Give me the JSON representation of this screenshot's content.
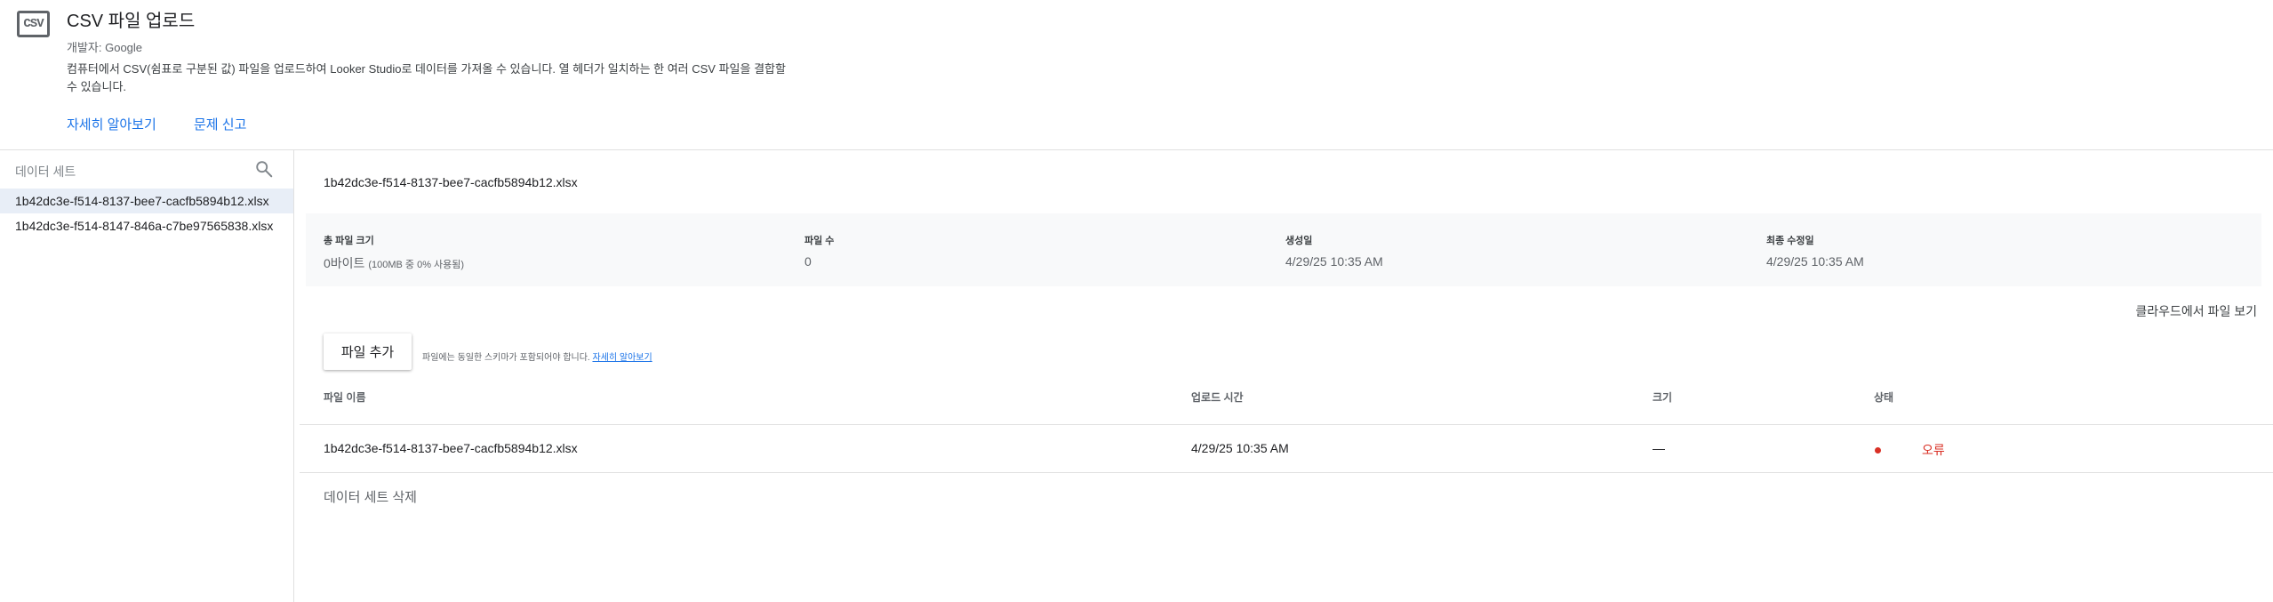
{
  "connector": {
    "logo_text": "CSV",
    "title": "CSV 파일 업로드",
    "developer": "개발자: Google",
    "description": "컴퓨터에서 CSV(쉼표로 구분된 값) 파일을 업로드하여 Looker Studio로 데이터를 가져올 수 있습니다. 열 헤더가 일치하는 한 여러 CSV 파일을 결합할 수 있습니다.",
    "learn_more": "자세히 알아보기",
    "report_issue": "문제 신고"
  },
  "sidebar": {
    "search_placeholder": "데이터 세트",
    "search_icon": "search-icon",
    "items": [
      {
        "label": "1b42dc3e-f514-8137-bee7-cacfb5894b12.xlsx",
        "active": true
      },
      {
        "label": "1b42dc3e-f514-8147-846a-c7be97565838.xlsx",
        "active": false
      }
    ]
  },
  "main": {
    "dataset_title": "1b42dc3e-f514-8137-bee7-cacfb5894b12.xlsx",
    "stats": {
      "total_size_label": "총 파일 크기",
      "total_size_value": "0바이트",
      "total_size_sub": "(100MB 중 0% 사용됨)",
      "file_count_label": "파일 수",
      "file_count_value": "0",
      "created_label": "생성일",
      "created_value": "4/29/25 10:35 AM",
      "modified_label": "최종 수정일",
      "modified_value": "4/29/25 10:35 AM"
    },
    "cloud_link": "클라우드에서 파일 보기",
    "add_file_button": "파일 추가",
    "hint_text": "파일에는 동일한 스키마가 포함되어야 합니다.",
    "hint_link": "자세히 알아보기",
    "table": {
      "headers": {
        "name": "파일 이름",
        "upload_time": "업로드 시간",
        "size": "크기",
        "status": "상태"
      },
      "rows": [
        {
          "name": "1b42dc3e-f514-8137-bee7-cacfb5894b12.xlsx",
          "upload_time": "4/29/25 10:35 AM",
          "size": "—",
          "status": "오류"
        }
      ]
    },
    "delete_dataset": "데이터 세트 삭제",
    "colors": {
      "link": "#1a73e8",
      "error": "#d93025",
      "active_row": "#e8eef7"
    }
  }
}
